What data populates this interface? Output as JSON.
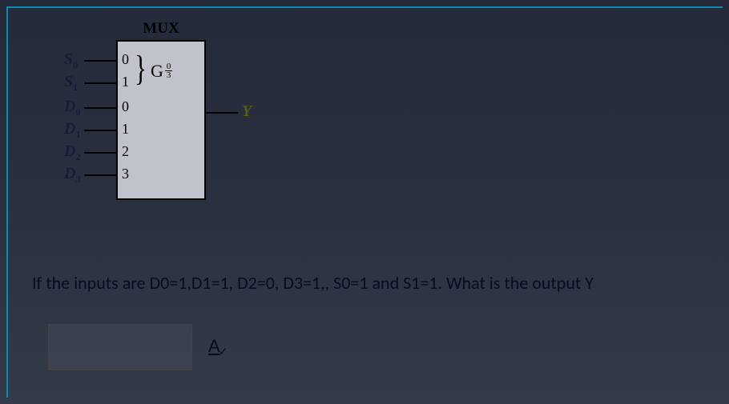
{
  "diagram": {
    "title": "MUX",
    "inputs": [
      {
        "label": "S",
        "sub": "0",
        "pin": "0"
      },
      {
        "label": "S",
        "sub": "1",
        "pin": "1"
      },
      {
        "label": "D",
        "sub": "0",
        "pin": "0"
      },
      {
        "label": "D",
        "sub": "1",
        "pin": "1"
      },
      {
        "label": "D",
        "sub": "2",
        "pin": "2"
      },
      {
        "label": "D",
        "sub": "3",
        "pin": "3"
      }
    ],
    "gate_label": "G",
    "gate_frac_top": "0",
    "gate_frac_bot": "3",
    "output_label": "Y"
  },
  "question_text": "If the inputs are D0=1,D1=1, D2=0, D3=1,, S0=1  and  S1=1.  What is the output Y",
  "answer_placeholder": "",
  "validate_glyph": "A∨"
}
